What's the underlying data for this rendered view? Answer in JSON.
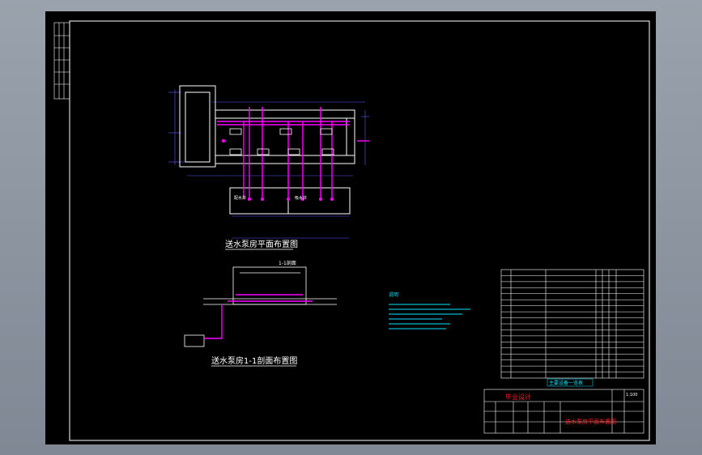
{
  "plan_view": {
    "title": "送水泵房平面布置图",
    "room_labels": [
      "配水井",
      "吸水井"
    ]
  },
  "section_view": {
    "title": "送水泵房1-1剖面布置图",
    "label": "1-1剖面"
  },
  "notes": {
    "heading": "说明"
  },
  "equipment_table": {
    "caption": "主要设备一览表"
  },
  "title_block": {
    "project": "毕业设计",
    "drawing_name": "送水泵房平面布置图",
    "scale": "1:100"
  },
  "colors": {
    "background": "#000000",
    "line_white": "#ffffff",
    "pipe_magenta": "#ff00ff",
    "dim_blue": "#5a5aff",
    "text_cyan": "#00e5ff",
    "title_red": "#ff2020",
    "table_yellow": "#e6e600"
  }
}
